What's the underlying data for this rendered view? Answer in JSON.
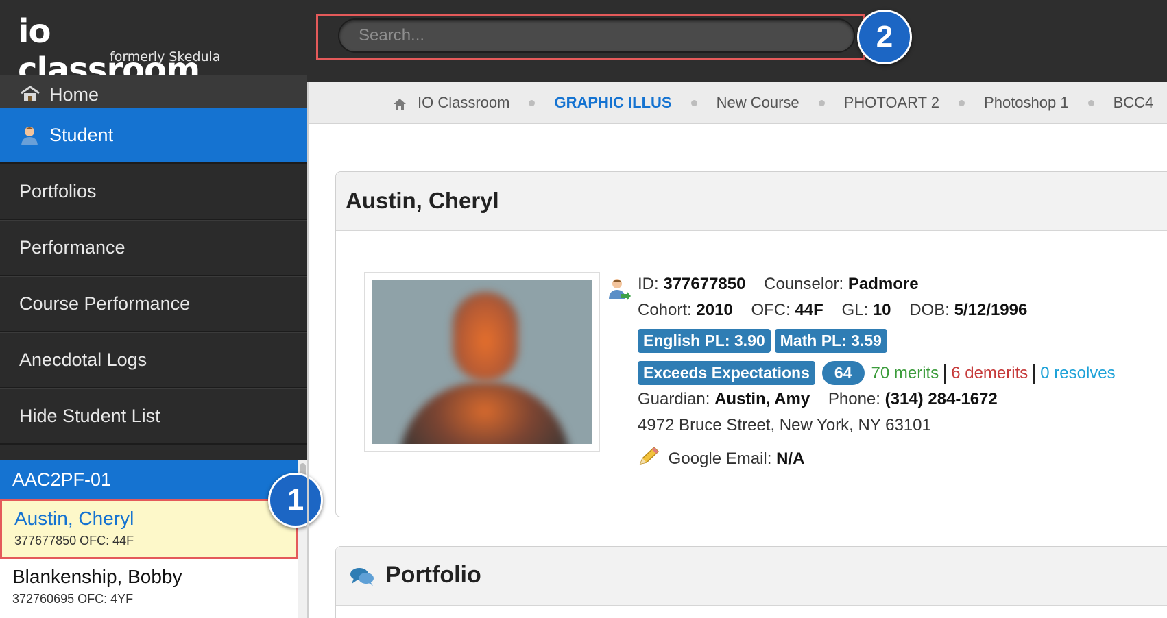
{
  "header": {
    "logo_main": "io classroom",
    "logo_sub": "formerly Skedula",
    "search_placeholder": "Search..."
  },
  "callouts": {
    "search": "2",
    "student": "1"
  },
  "sidebar": {
    "items": [
      {
        "label": "Home",
        "icon": "home-icon"
      },
      {
        "label": "Student",
        "icon": "student-icon",
        "active": true
      },
      {
        "label": "Portfolios"
      },
      {
        "label": "Performance"
      },
      {
        "label": "Course Performance"
      },
      {
        "label": "Anecdotal Logs"
      },
      {
        "label": "Hide Student List"
      }
    ],
    "class_code": "AAC2PF-01",
    "students": [
      {
        "name": "Austin, Cheryl",
        "meta": "377677850 OFC: 44F",
        "selected": true
      },
      {
        "name": "Blankenship, Bobby",
        "meta": "372760695 OFC: 4YF"
      }
    ]
  },
  "breadcrumbs": [
    {
      "label": "IO Classroom"
    },
    {
      "label": "GRAPHIC ILLUS",
      "current": true
    },
    {
      "label": "New Course"
    },
    {
      "label": "PHOTOART 2"
    },
    {
      "label": "Photoshop 1"
    },
    {
      "label": "BCC4"
    }
  ],
  "profile": {
    "name": "Austin, Cheryl",
    "id_label": "ID:",
    "id": "377677850",
    "counselor_label": "Counselor:",
    "counselor": "Padmore",
    "cohort_label": "Cohort:",
    "cohort": "2010",
    "ofc_label": "OFC:",
    "ofc": "44F",
    "gl_label": "GL:",
    "gl": "10",
    "dob_label": "DOB:",
    "dob": "5/12/1996",
    "english_pl": "English PL: 3.90",
    "math_pl": "Math PL: 3.59",
    "expectation": "Exceeds Expectations",
    "score": "64",
    "merits": "70 merits",
    "demerits": "6 demerits",
    "resolves": "0 resolves",
    "guardian_label": "Guardian:",
    "guardian": "Austin, Amy",
    "phone_label": "Phone:",
    "phone": "(314) 284-1672",
    "address": "4972 Bruce Street, New York, NY 63101",
    "google_email_label": "Google Email:",
    "google_email": "N/A"
  },
  "portfolio": {
    "title": "Portfolio"
  },
  "colors": {
    "topbar": "#2e2e2e",
    "sidebar": "#2b2b2b",
    "accent_blue": "#1573d1",
    "tag_blue": "#2f7db4",
    "callout_border": "#e45a5a",
    "merits": "#3b9c3b",
    "demerits": "#c63a3a",
    "resolves": "#1ea2d8"
  }
}
